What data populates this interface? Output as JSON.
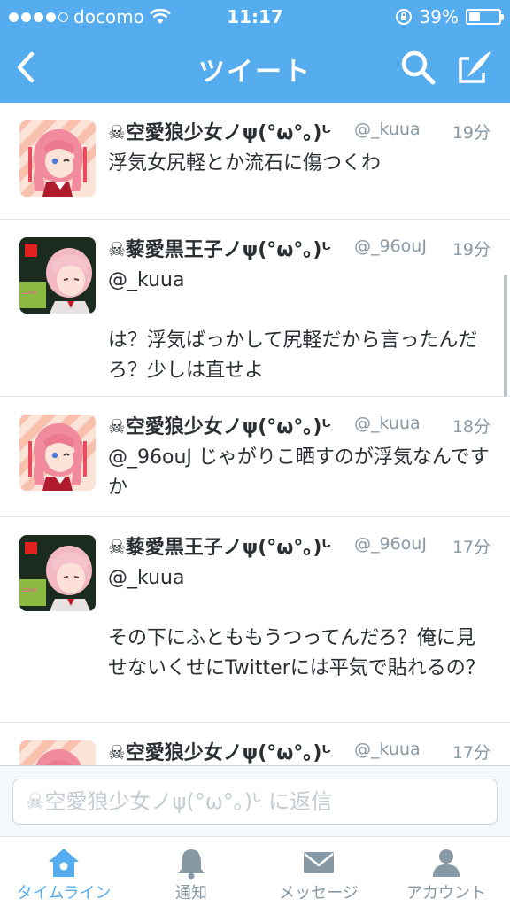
{
  "status_bar": {
    "carrier": "docomo",
    "time": "11:17",
    "battery": "39%",
    "battery_level": 0.39
  },
  "nav": {
    "title": "ツイート",
    "back_icon": "chevron-left-icon",
    "search_icon": "search-icon",
    "compose_icon": "compose-icon"
  },
  "tweets": [
    {
      "name": "☠空愛狼少女ノψ(°ω°｡)ᒡ",
      "handle": "@_kuua",
      "time": "19分",
      "text": "浮気女尻軽とか流石に傷つくわ",
      "avatar": "pink-hair-girl-avatar"
    },
    {
      "name": "☠藜愛黒王子ノψ(°ω°｡)ᒡ",
      "handle": "@_96ouJ",
      "time": "19分",
      "text": "@_kuua\n\nは？浮気ばっかして尻軽だから言ったんだろ？少しは直せよ",
      "avatar": "pink-hair-boy-avatar"
    },
    {
      "name": "☠空愛狼少女ノψ(°ω°｡)ᒡ",
      "handle": "@_kuua",
      "time": "18分",
      "text": "@_96ouJ じゃがりこ晒すのが浮気なんですか",
      "avatar": "pink-hair-girl-avatar"
    },
    {
      "name": "☠藜愛黒王子ノψ(°ω°｡)ᒡ",
      "handle": "@_96ouJ",
      "time": "17分",
      "text": "@_kuua\n\nその下にふとももうつってんだろ？俺に見せないくせにTwitterには平気で貼れるの？",
      "avatar": "pink-hair-boy-avatar"
    },
    {
      "name": "☠空愛狼少女ノψ(°ω°｡)ᒡ",
      "handle": "@_kuua",
      "time": "17分",
      "text": "",
      "avatar": "pink-hair-girl-avatar"
    }
  ],
  "reply": {
    "placeholder": "☠空愛狼少女ノψ(°ω°｡)ᒡ に返信"
  },
  "tabs": [
    {
      "label": "タイムライン",
      "icon": "home-icon",
      "active": true
    },
    {
      "label": "通知",
      "icon": "bell-icon",
      "active": false
    },
    {
      "label": "メッセージ",
      "icon": "envelope-icon",
      "active": false
    },
    {
      "label": "アカウント",
      "icon": "person-icon",
      "active": false
    }
  ],
  "colors": {
    "brand": "#55acee",
    "text": "#292f33",
    "muted": "#8899a6"
  }
}
